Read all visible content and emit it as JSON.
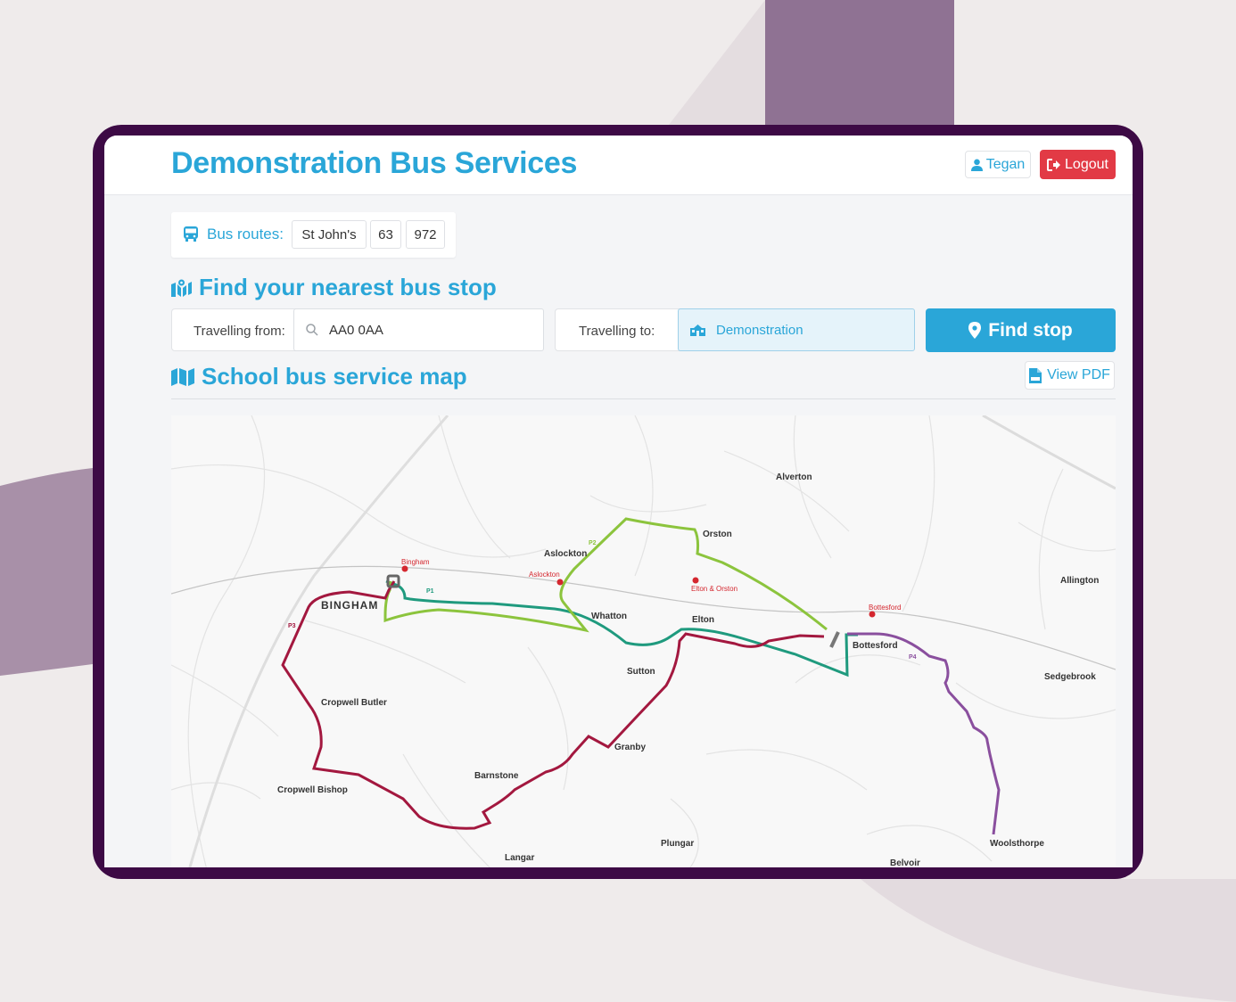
{
  "header": {
    "title": "Demonstration Bus Services",
    "user_label": "Tegan",
    "logout_label": "Logout"
  },
  "routes": {
    "label": "Bus routes:",
    "items": [
      "St John's",
      "63",
      "972"
    ]
  },
  "finder": {
    "heading": "Find your nearest bus stop",
    "from_label": "Travelling from:",
    "from_value": "AA0 0AA",
    "to_label": "Travelling to:",
    "to_value": "Demonstration",
    "button_label": "Find stop"
  },
  "map_section": {
    "heading": "School bus service map",
    "pdf_label": "View PDF"
  },
  "colors": {
    "accent": "#2aa6d8",
    "danger": "#e23a45",
    "frame": "#3d0a45",
    "route_p1": "#1f9a7e",
    "route_p2": "#8cc43d",
    "route_p3": "#a3183f",
    "route_p4": "#8a4f9e"
  },
  "map": {
    "towns": {
      "alverton": "Alverton",
      "orston": "Orston",
      "aslockton": "Aslockton",
      "bingham": "BINGHAM",
      "whatton": "Whatton",
      "elton": "Elton",
      "bottesford": "Bottesford",
      "allington": "Allington",
      "sedgebrook": "Sedgebrook",
      "sutton": "Sutton",
      "cropwell_butler": "Cropwell Butler",
      "cropwell_bishop": "Cropwell Bishop",
      "granby": "Granby",
      "barnstone": "Barnstone",
      "langar": "Langar",
      "plungar": "Plungar",
      "woolsthorpe": "Woolsthorpe",
      "belvoir": "Belvoir"
    },
    "stations": {
      "bingham": "Bingham",
      "aslockton": "Aslockton",
      "elton": "Elton\n& Orston",
      "bottesford": "Bottesford"
    },
    "route_labels": {
      "p1": "P1",
      "p2": "P2",
      "p3": "P3",
      "p4": "P4"
    }
  }
}
